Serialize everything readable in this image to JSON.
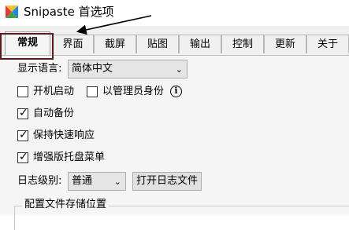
{
  "window": {
    "title": "Snipaste 首选项"
  },
  "tabs": [
    {
      "label": "常规",
      "active": true
    },
    {
      "label": "界面",
      "active": false
    },
    {
      "label": "截屏",
      "active": false
    },
    {
      "label": "贴图",
      "active": false
    },
    {
      "label": "输出",
      "active": false
    },
    {
      "label": "控制",
      "active": false
    },
    {
      "label": "更新",
      "active": false
    },
    {
      "label": "关于",
      "active": false
    }
  ],
  "general": {
    "language_label": "显示语言:",
    "language_value": "简体中文",
    "checkboxes": [
      {
        "label": "开机启动",
        "checked": false
      },
      {
        "label": "以管理员身份",
        "checked": false
      },
      {
        "label": "自动备份",
        "checked": true
      },
      {
        "label": "保持快速响应",
        "checked": true
      },
      {
        "label": "增强版托盘菜单",
        "checked": true
      }
    ],
    "log_level_label": "日志级别:",
    "log_level_value": "普通",
    "open_log_button": "打开日志文件",
    "config_group_title": "配置文件存储位置"
  },
  "icons": {
    "logo": "snipaste-logo-icon",
    "info": "info-icon",
    "dropdown": "chevron-down-icon",
    "check": "check-icon"
  },
  "colors": {
    "annotation": "#5a1a1a",
    "combo_background": "#e5e5e5",
    "panel_background": "#f5f5f5"
  }
}
